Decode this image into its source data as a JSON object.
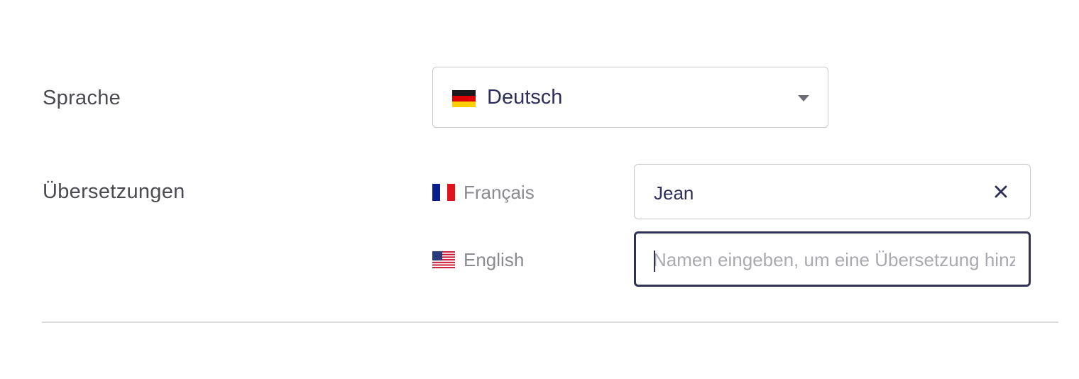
{
  "form": {
    "language_label": "Sprache",
    "translations_label": "Übersetzungen"
  },
  "language_select": {
    "value": "Deutsch",
    "flag_icon": "flag-germany-icon"
  },
  "translations": [
    {
      "language": "Français",
      "flag_icon": "flag-france-icon",
      "value": "Jean"
    },
    {
      "language": "English",
      "flag_icon": "flag-usa-icon",
      "value": "",
      "placeholder": "Namen eingeben, um eine Übersetzung hinzuzufügen",
      "focused": true
    }
  ],
  "colors": {
    "text_primary": "#2e2e5a",
    "text_label": "#4a4a52",
    "text_muted": "#8a8a90",
    "focus_border": "#2f3157",
    "border": "#c9c9cf"
  }
}
